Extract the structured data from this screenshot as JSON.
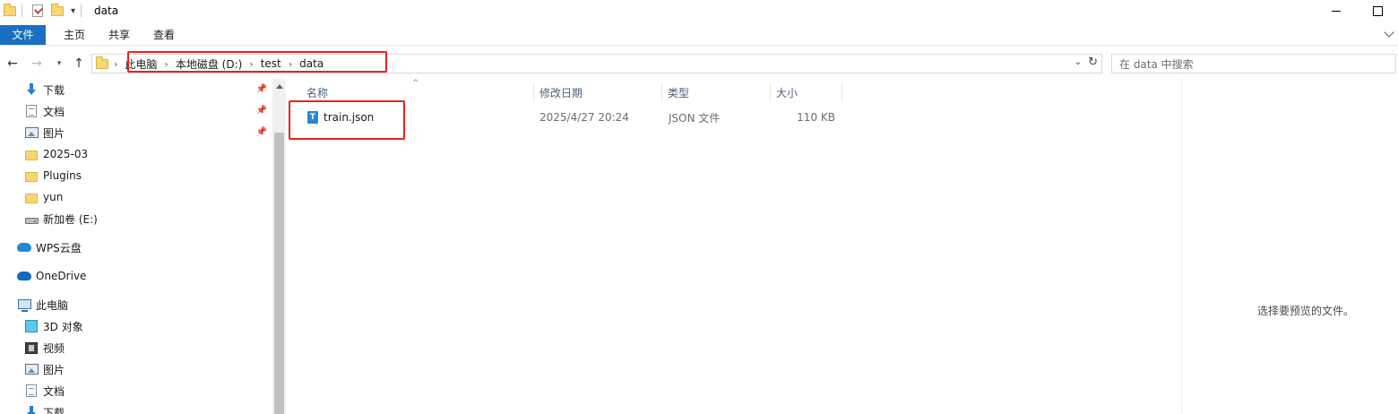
{
  "window": {
    "title": "data"
  },
  "ribbon": {
    "tabs": [
      "文件",
      "主页",
      "共享",
      "查看"
    ]
  },
  "address": {
    "crumbs": [
      "此电脑",
      "本地磁盘 (D:)",
      "test",
      "data"
    ]
  },
  "search": {
    "placeholder": "在 data 中搜索"
  },
  "sidebar": {
    "items": [
      {
        "label": "下载",
        "icon": "download-icon",
        "pinned": true
      },
      {
        "label": "文档",
        "icon": "document-icon",
        "pinned": true
      },
      {
        "label": "图片",
        "icon": "picture-icon",
        "pinned": true
      },
      {
        "label": "2025-03",
        "icon": "folder-icon"
      },
      {
        "label": "Plugins",
        "icon": "folder-icon"
      },
      {
        "label": "yun",
        "icon": "folder-icon"
      },
      {
        "label": "新加卷 (E:)",
        "icon": "drive-icon"
      },
      {
        "label": "WPS云盘",
        "icon": "wps-cloud-icon"
      },
      {
        "label": "OneDrive",
        "icon": "onedrive-icon"
      },
      {
        "label": "此电脑",
        "icon": "this-pc-icon"
      },
      {
        "label": "3D 对象",
        "icon": "3d-objects-icon"
      },
      {
        "label": "视频",
        "icon": "video-icon"
      },
      {
        "label": "图片",
        "icon": "picture-icon"
      },
      {
        "label": "文档",
        "icon": "document-icon"
      },
      {
        "label": "下载",
        "icon": "download-icon"
      }
    ]
  },
  "columns": [
    "名称",
    "修改日期",
    "类型",
    "大小"
  ],
  "files": [
    {
      "name": "train.json",
      "modified": "2025/4/27 20:24",
      "type": "JSON 文件",
      "size": "110 KB",
      "icon": "json-file-icon"
    }
  ],
  "preview": {
    "empty_text": "选择要预览的文件。"
  },
  "colors": {
    "accent": "#1a6fc0",
    "highlight": "#e8221e"
  }
}
